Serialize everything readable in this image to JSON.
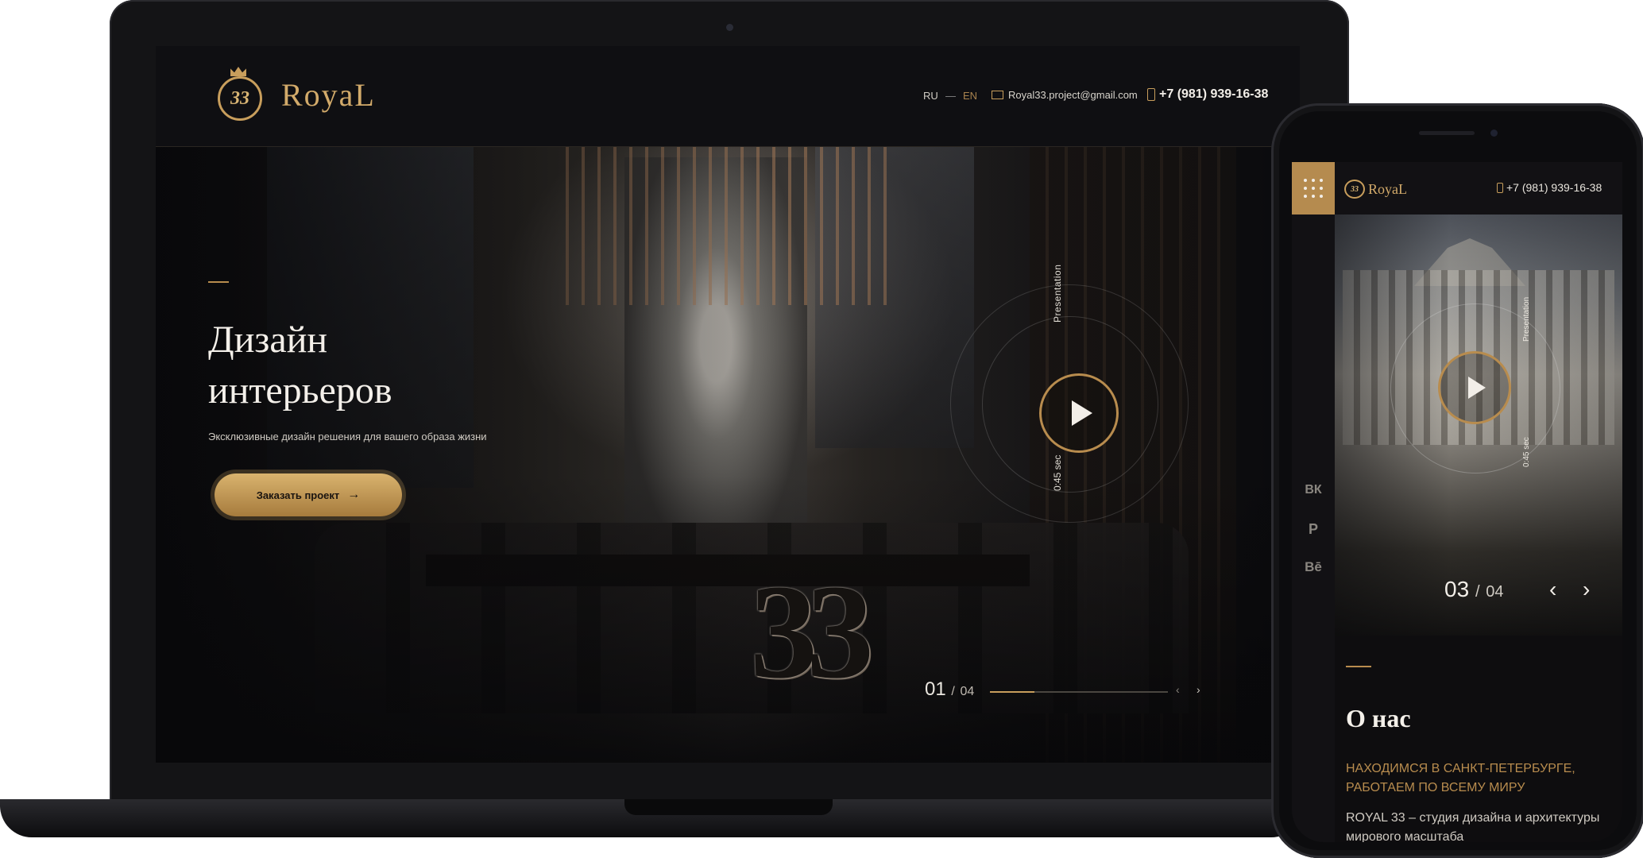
{
  "desktop": {
    "logo": {
      "number": "33",
      "name": "RoyaL"
    },
    "nav": {
      "lang_ru": "RU",
      "lang_sep": "—",
      "lang_en": "EN",
      "email": "Royal33.project@gmail.com",
      "phone": "+7 (981) 939-16-38"
    },
    "hero": {
      "title_line1": "Дизайн",
      "title_line2": "интерьеров",
      "subtitle": "Эксклюзивные дизайн решения для вашего образа жизни",
      "cta_label": "Заказать проект",
      "arrow": "→"
    },
    "video": {
      "label": "Presentation",
      "duration": "0:45 sec"
    },
    "decor_number": "33",
    "slider": {
      "current": "01",
      "sep": "/",
      "total": "04",
      "progress": 0.25,
      "prev": "‹",
      "next": "›"
    }
  },
  "mobile": {
    "logo": {
      "number": "33",
      "name": "RoyaL"
    },
    "phone": "+7 (981) 939-16-38",
    "social": {
      "vk": "ВК",
      "pinterest": "P",
      "behance": "Bē"
    },
    "video": {
      "label": "Presentation",
      "duration": "0:45 sec"
    },
    "slider": {
      "current": "03",
      "sep": "/",
      "total": "04",
      "prev": "‹",
      "next": "›"
    },
    "about": {
      "title": "О нас",
      "tagline": "НАХОДИМСЯ В САНКТ-ПЕТЕРБУРГЕ, РАБОТАЕМ ПО ВСЕМУ МИРУ",
      "text": "ROYAL 33 – студия дизайна и архитектуры мирового масштаба"
    }
  },
  "colors": {
    "gold": "#c89e5c",
    "dark": "#0f0f12",
    "text_light": "#f4f0ea"
  }
}
